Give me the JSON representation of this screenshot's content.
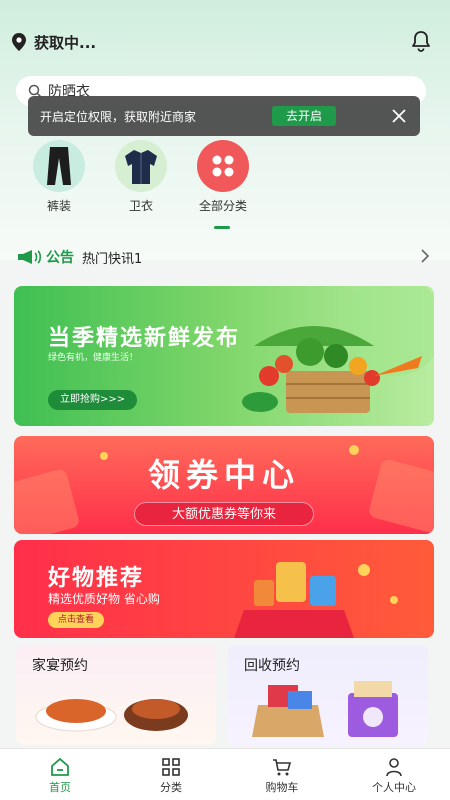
{
  "header": {
    "location_text": "获取中..."
  },
  "search": {
    "value": "防晒衣"
  },
  "toast": {
    "message": "开启定位权限，获取附近商家",
    "button": "去开启"
  },
  "categories": [
    {
      "label": "裤装"
    },
    {
      "label": "卫衣"
    },
    {
      "label": "全部分类"
    }
  ],
  "notice": {
    "title": "公告",
    "text": "热门快讯1"
  },
  "banners": {
    "fresh": {
      "title": "当季精选新鲜发布",
      "subtitle": "绿色有机，健康生活！",
      "button": "立即抢购>>>"
    },
    "coupon": {
      "title": "领券中心",
      "subtitle": "大额优惠券等你来"
    },
    "recommend": {
      "title": "好物推荐",
      "subtitle": "精选优质好物 省心购",
      "button": "点击查看"
    }
  },
  "cards": [
    {
      "title": "家宴预约"
    },
    {
      "title": "回收预约"
    }
  ],
  "tabbar": [
    {
      "label": "首页"
    },
    {
      "label": "分类"
    },
    {
      "label": "购物车"
    },
    {
      "label": "个人中心"
    }
  ],
  "colors": {
    "accent": "#1e9a4a",
    "coupon_red": "#ff2f4a"
  }
}
